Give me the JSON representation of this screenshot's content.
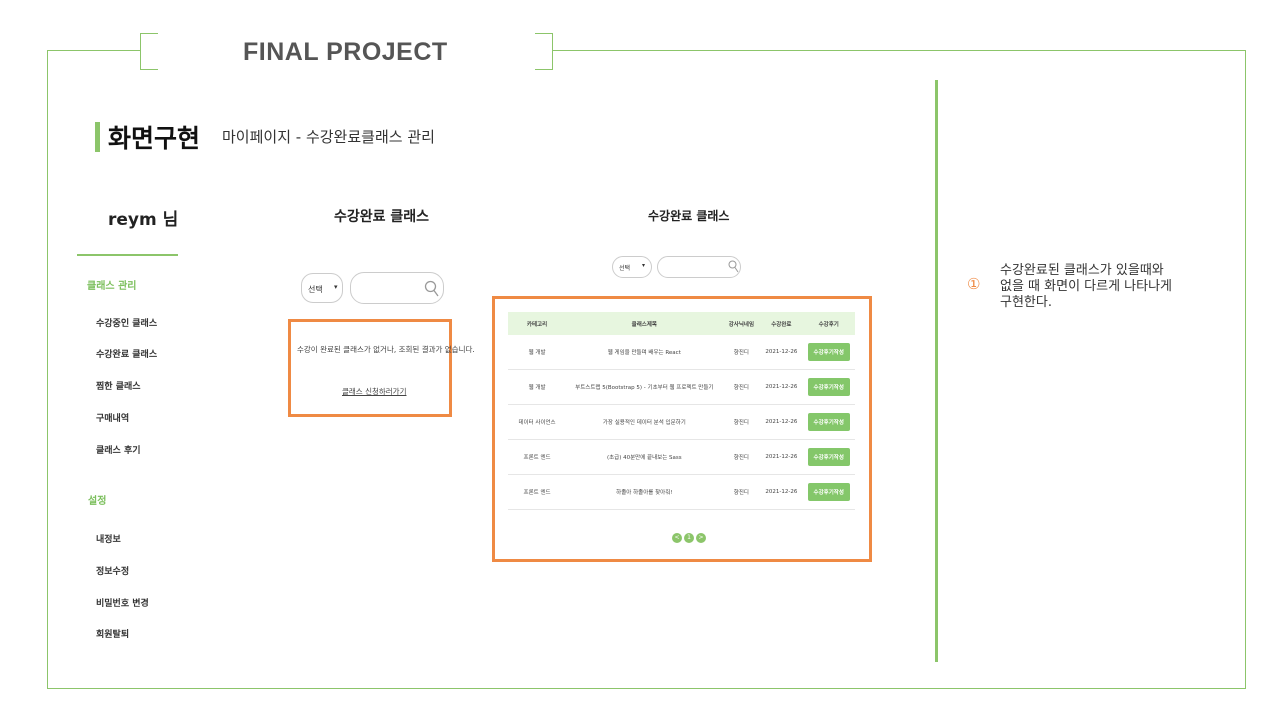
{
  "header": {
    "title": "FINAL PROJECT"
  },
  "section": {
    "title": "화면구현",
    "subtitle": "마이페이지 - 수강완료클래스 관리"
  },
  "sidebar": {
    "user": "reym 님",
    "group1": "클래스 관리",
    "items1": [
      "수강중인 클래스",
      "수강완료 클래스",
      "찜한 클래스",
      "구매내역",
      "클래스 후기"
    ],
    "group2": "설정",
    "items2": [
      "내정보",
      "정보수정",
      "비밀번호 변경",
      "회원탈퇴"
    ]
  },
  "empty_panel": {
    "title": "수강완료 클래스",
    "select_value": "선택",
    "message": "수강이 완료된 클래스가 없거나, 조회된 결과가 없습니다.",
    "link": "클래스 신청하러가기"
  },
  "list_panel": {
    "title": "수강완료 클래스",
    "select_value": "선택",
    "columns": [
      "카테고리",
      "클래스제목",
      "강사닉네임",
      "수강완료",
      "수강후기"
    ],
    "rows": [
      [
        "웹 개발",
        "웹 게임을 만들며 배우는 React",
        "향진디",
        "2021-12-26",
        "수강후기작성"
      ],
      [
        "웹 개발",
        "부트스트랩 5(Bootstrap 5) - 기초부터 웹 프로젝트 만들기",
        "향진디",
        "2021-12-26",
        "수강후기작성"
      ],
      [
        "데이터 사이언스",
        "가장 실용적인 데이터 분석 입문하기",
        "향진디",
        "2021-12-26",
        "수강후기작성"
      ],
      [
        "프론트 엔드",
        "(초급) 40분만에 끝내보는 Sass",
        "향진디",
        "2021-12-26",
        "수강후기작성"
      ],
      [
        "프론트 엔드",
        "하졸아 하졸아를 찾아줘!",
        "향진디",
        "2021-12-26",
        "수강후기작성"
      ]
    ],
    "pages": [
      "<",
      "1",
      ">"
    ]
  },
  "note": {
    "number": "①",
    "text": "수강완료된 클래스가 있을때와\n없을 때 화면이 다르게 나타나게\n 구현한다."
  },
  "colors": {
    "accent_green": "#8cc56a",
    "highlight_orange": "#ef8a44"
  }
}
